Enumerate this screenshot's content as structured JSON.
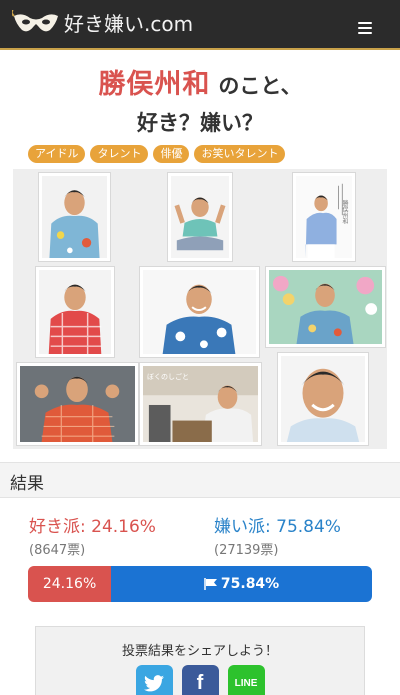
{
  "header": {
    "logo_text": "好き嫌い.com",
    "logo_icon": "mask-icon",
    "menu_icon": "hamburger-menu-icon",
    "bg_color": "#2b2b2b"
  },
  "title": {
    "name": "勝俣州和",
    "suffix": "のこと、",
    "subtitle": "好き？嫌い？"
  },
  "tags": [
    "アイドル",
    "タレント",
    "俳優",
    "お笑いタレント"
  ],
  "gallery": {
    "photos": [
      {
        "name": "photo-hawaiian-shirt"
      },
      {
        "name": "photo-sitting-cross-legged"
      },
      {
        "name": "photo-book-cover"
      },
      {
        "name": "photo-red-plaid-shirt"
      },
      {
        "name": "photo-blue-aloha-shirt"
      },
      {
        "name": "photo-flower-shirt"
      },
      {
        "name": "photo-fist-pose"
      },
      {
        "name": "photo-office-interview"
      },
      {
        "name": "photo-closeup-smile"
      }
    ],
    "book_cover_text": "勝俣州和",
    "interview_caption": "ぼくのしごと"
  },
  "results": {
    "header": "結果",
    "like_label": "好き派: 24.16%",
    "dislike_label": "嫌い派: 75.84%",
    "like_votes": "(8647票)",
    "dislike_votes": "(27139票)",
    "like_percent": 24.16,
    "dislike_percent": 75.84,
    "bar_like_text": "24.16%",
    "bar_dislike_text": "75.84%",
    "like_color": "#d9534f",
    "dislike_color": "#1b73d3"
  },
  "share": {
    "title": "投票結果をシェアしよう！",
    "buttons": [
      {
        "name": "twitter",
        "icon": "twitter-bird-icon"
      },
      {
        "name": "facebook",
        "label": "f"
      },
      {
        "name": "line",
        "label": "LINE"
      }
    ]
  }
}
